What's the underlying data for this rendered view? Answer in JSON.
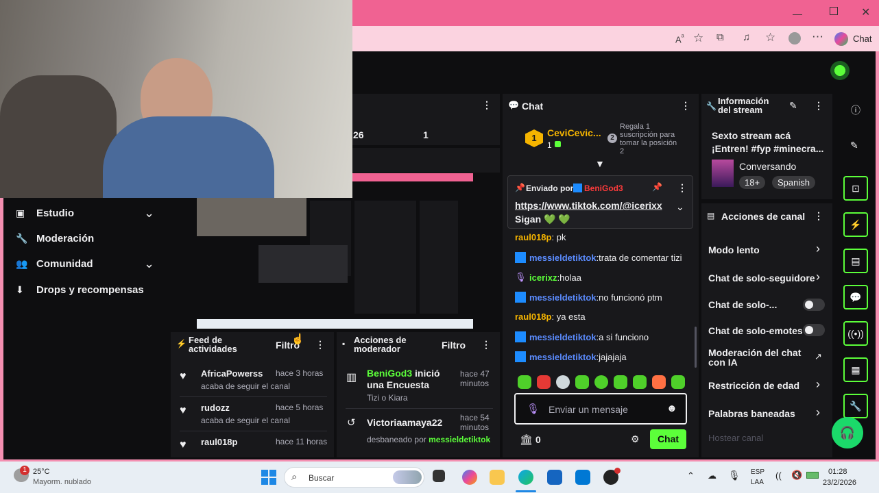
{
  "browser": {
    "chat_label": "Chat"
  },
  "nav": {
    "items": [
      {
        "label": "Estudio"
      },
      {
        "label": "Moderación"
      },
      {
        "label": "Comunidad"
      },
      {
        "label": "Drops y recompensas"
      }
    ]
  },
  "stats": {
    "a": "26",
    "b": "1"
  },
  "chat": {
    "title": "Chat",
    "gifter": {
      "name": "CeviCevic...",
      "count": "1",
      "text": "Regala 1 suscripción para tomar la posición 2",
      "rank": "2"
    },
    "pinned": {
      "prefix": "Enviado por",
      "user": "BeniGod3",
      "link": "https://www.tiktok.com/@icerixx",
      "text": "Sigan 💚 💚"
    },
    "messages": [
      {
        "user": "raul018p",
        "text": "pk",
        "icon": false
      },
      {
        "user": "messieldetiktok",
        "text": "trata de comentar tizi",
        "icon": true
      },
      {
        "user": "icerixz",
        "text": "holaa",
        "icon": true
      },
      {
        "user": "messieldetiktok",
        "text": "no funcionó ptm",
        "icon": true
      },
      {
        "user": "raul018p",
        "text": "ya esta",
        "icon": false
      },
      {
        "user": "messieldetiktok",
        "text": "a si funciono",
        "icon": true
      },
      {
        "user": "messieldetiktok",
        "text": "jajajaja",
        "icon": true
      }
    ],
    "input_placeholder": "Enviar un mensaje",
    "points": "0",
    "send_label": "Chat"
  },
  "stream_info": {
    "title": "Información del stream",
    "stream_title": "Sexto stream acá ¡Entren! #fyp #minecra...",
    "category": "Conversando",
    "tags": [
      "18+",
      "Spanish"
    ]
  },
  "channel_actions": {
    "title": "Acciones de canal",
    "items": [
      {
        "label": "Modo lento",
        "control": "chevron"
      },
      {
        "label": "Chat de solo-seguidore",
        "control": "chevron"
      },
      {
        "label": "Chat de solo-...",
        "control": "toggle"
      },
      {
        "label": "Chat de solo-emotes",
        "control": "toggle"
      },
      {
        "label": "Moderación del chat con IA",
        "control": "external"
      },
      {
        "label": "Restricción de edad",
        "control": "chevron"
      },
      {
        "label": "Palabras baneadas",
        "control": "chevron"
      }
    ],
    "disabled_item": "Hostear canal"
  },
  "activity_feed": {
    "title": "Feed de actividades",
    "filter": "Filtro",
    "items": [
      {
        "user": "AfricaPowerss",
        "time": "hace 3 horas",
        "text": "acaba de seguir el canal"
      },
      {
        "user": "rudozz",
        "time": "hace 5 horas",
        "text": "acaba de seguir el canal"
      },
      {
        "user": "raul018p",
        "time": "hace 11 horas",
        "text": ""
      }
    ]
  },
  "mod_actions": {
    "title": "Acciones de moderador",
    "filter": "Filtro",
    "items": [
      {
        "user": "BeniGod3",
        "text": "inició una Encuesta",
        "sub": "Tizi o Kiara",
        "time": "hace 47 minutos"
      },
      {
        "user": "Victoriaamaya22",
        "text": "",
        "sub_prefix": "desbaneado por",
        "sub_user": "messieldetiktok",
        "time": "hace 54 minutos"
      }
    ]
  },
  "taskbar": {
    "weather_temp": "25°C",
    "weather_desc": "Mayorm. nublado",
    "weather_badge": "1",
    "search": "Buscar",
    "lang1": "ESP",
    "lang2": "LAA",
    "time": "01:28",
    "date": "23/2/2026"
  },
  "colors": {
    "accent": "#5cff3a",
    "user": "#5b8cff",
    "pink": "#f06292"
  }
}
